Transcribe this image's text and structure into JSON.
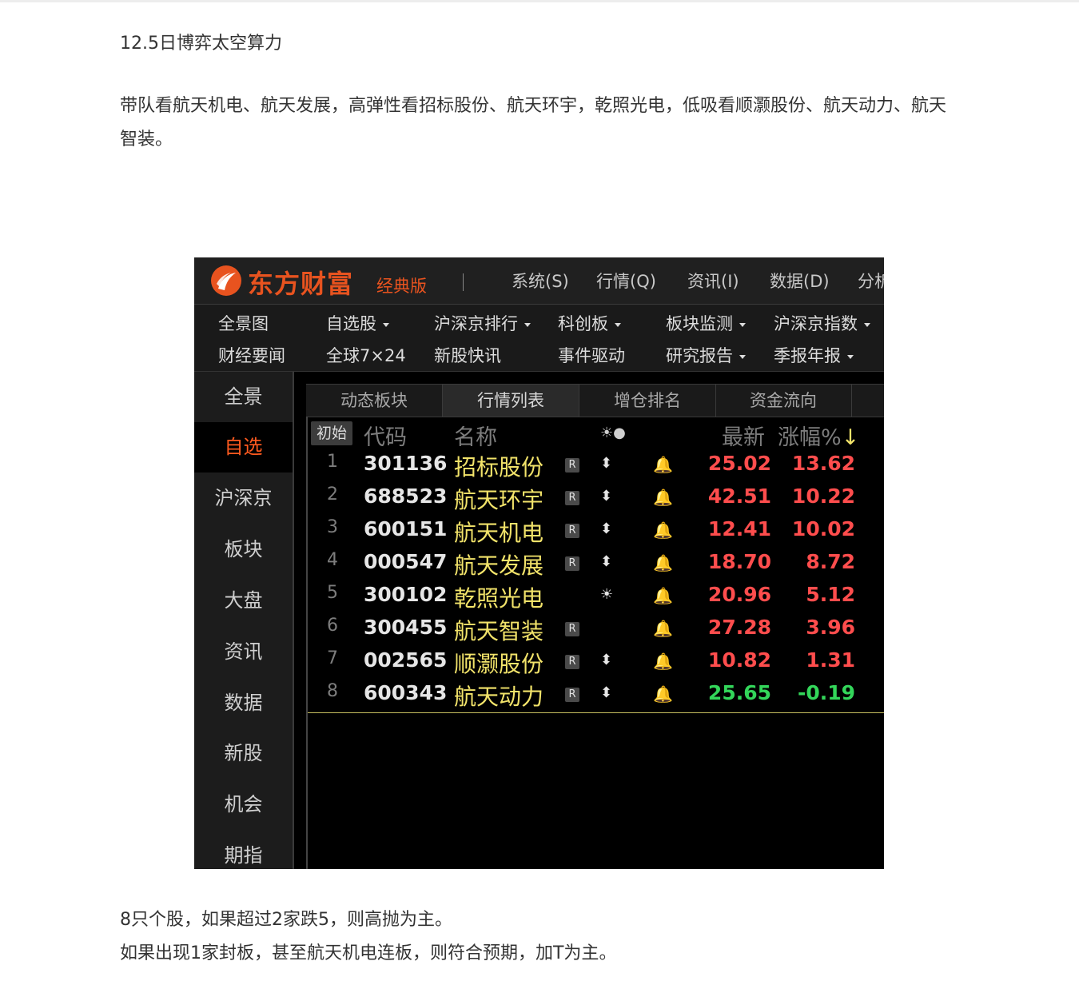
{
  "article": {
    "title": "12.5日博弈太空算力",
    "intro": "带队看航天机电、航天发展，高弹性看招标股份、航天环宇，乾照光电，低吸看顺灏股份、航天动力、航天智装。",
    "rule1": "8只个股，如果超过2家跌5，则高抛为主。",
    "rule2": "如果出现1家封板，甚至航天机电连板，则符合预期，加T为主。"
  },
  "app": {
    "brand": "东方财富",
    "edition": "经典版",
    "menu": [
      "系统(S)",
      "行情(Q)",
      "资讯(I)",
      "数据(D)",
      "分析"
    ],
    "quicknav_row1": [
      {
        "label": "全景图",
        "dropdown": false
      },
      {
        "label": "自选股",
        "dropdown": true
      },
      {
        "label": "沪深京排行",
        "dropdown": true
      },
      {
        "label": "科创板",
        "dropdown": true
      },
      {
        "label": "板块监测",
        "dropdown": true
      },
      {
        "label": "沪深京指数",
        "dropdown": true
      }
    ],
    "quicknav_row2": [
      {
        "label": "财经要闻",
        "dropdown": false
      },
      {
        "label": "全球7×24",
        "dropdown": false
      },
      {
        "label": "新股快讯",
        "dropdown": false
      },
      {
        "label": "事件驱动",
        "dropdown": false
      },
      {
        "label": "研究报告",
        "dropdown": true
      },
      {
        "label": "季报年报",
        "dropdown": true
      }
    ],
    "sidebar": [
      "全景",
      "自选",
      "沪深京",
      "板块",
      "大盘",
      "资讯",
      "数据",
      "新股",
      "机会",
      "期指"
    ],
    "sidebar_active": "自选",
    "tabs": [
      "动态板块",
      "行情列表",
      "增仓排名",
      "资金流向"
    ],
    "active_tab": "行情列表",
    "table": {
      "reset_button": "初始",
      "headers": {
        "code": "代码",
        "name": "名称",
        "icons": "☀●",
        "latest": "最新",
        "change": "涨幅%",
        "sort_arrow": "↓"
      },
      "rows": [
        {
          "idx": "1",
          "code": "301136",
          "name": "招标股份",
          "r": true,
          "flag": "⬍",
          "price": "25.02",
          "change": "13.62",
          "dir": "up"
        },
        {
          "idx": "2",
          "code": "688523",
          "name": "航天环宇",
          "r": true,
          "flag": "⬍",
          "price": "42.51",
          "change": "10.22",
          "dir": "up"
        },
        {
          "idx": "3",
          "code": "600151",
          "name": "航天机电",
          "r": true,
          "flag": "⬍",
          "price": "12.41",
          "change": "10.02",
          "dir": "up"
        },
        {
          "idx": "4",
          "code": "000547",
          "name": "航天发展",
          "r": true,
          "flag": "⬍",
          "price": "18.70",
          "change": "8.72",
          "dir": "up"
        },
        {
          "idx": "5",
          "code": "300102",
          "name": "乾照光电",
          "r": false,
          "flag": "☀",
          "price": "20.96",
          "change": "5.12",
          "dir": "up"
        },
        {
          "idx": "6",
          "code": "300455",
          "name": "航天智装",
          "r": true,
          "flag": "",
          "price": "27.28",
          "change": "3.96",
          "dir": "up"
        },
        {
          "idx": "7",
          "code": "002565",
          "name": "顺灏股份",
          "r": true,
          "flag": "⬍",
          "price": "10.82",
          "change": "1.31",
          "dir": "up"
        },
        {
          "idx": "8",
          "code": "600343",
          "name": "航天动力",
          "r": true,
          "flag": "⬍",
          "price": "25.65",
          "change": "-0.19",
          "dir": "down"
        }
      ],
      "r_badge": "R",
      "bell_icon": "bell-icon"
    },
    "colors": {
      "brand": "#e8531f",
      "up": "#ff4d4d",
      "down": "#33d65a",
      "name": "#f2e36a"
    }
  }
}
